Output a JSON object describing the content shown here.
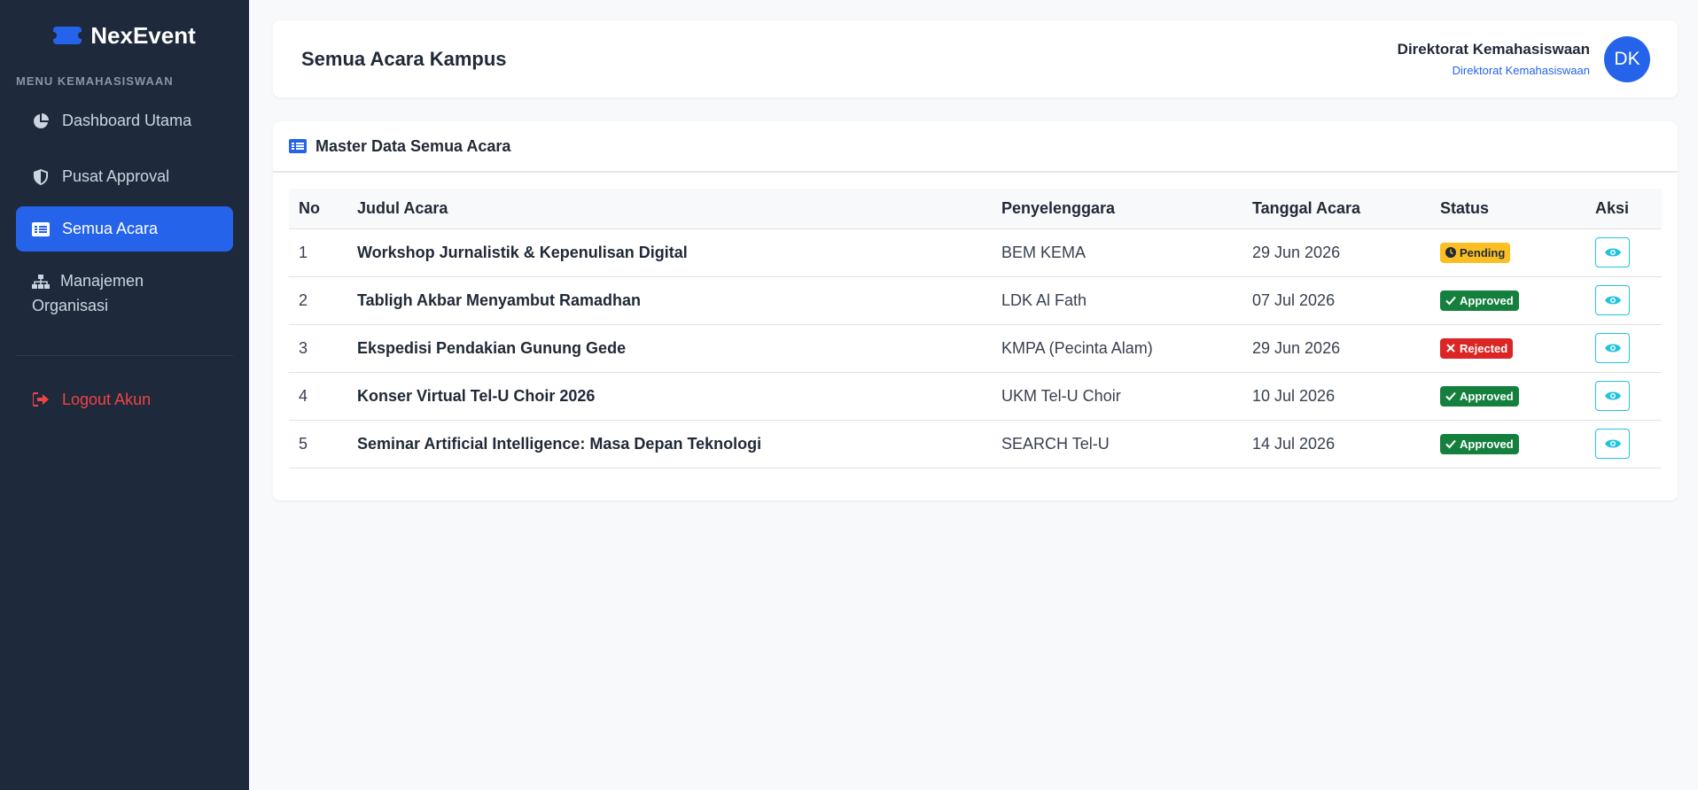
{
  "brand": {
    "name": "NexEvent"
  },
  "sidebar": {
    "heading": "MENU KEMAHASISWAAN",
    "items": [
      {
        "label": "Dashboard Utama",
        "icon": "pie-chart-icon"
      },
      {
        "label": "Pusat Approval",
        "icon": "shield-icon"
      },
      {
        "label": "Semua Acara",
        "icon": "list-icon",
        "active": true
      },
      {
        "label": "Manajemen Organisasi",
        "icon": "sitemap-icon"
      }
    ],
    "logout_label": "Logout Akun"
  },
  "header": {
    "title": "Semua Acara Kampus",
    "user_name": "Direktorat Kemahasiswaan",
    "user_role": "Direktorat Kemahasiswaan",
    "avatar_initials": "DK"
  },
  "card": {
    "title": "Master Data Semua Acara",
    "columns": [
      "No",
      "Judul Acara",
      "Penyelenggara",
      "Tanggal Acara",
      "Status",
      "Aksi"
    ],
    "rows": [
      {
        "no": "1",
        "title": "Workshop Jurnalistik & Kepenulisan Digital",
        "organizer": "BEM KEMA",
        "date": "29 Jun 2026",
        "status": "Pending"
      },
      {
        "no": "2",
        "title": "Tabligh Akbar Menyambut Ramadhan",
        "organizer": "LDK Al Fath",
        "date": "07 Jul 2026",
        "status": "Approved"
      },
      {
        "no": "3",
        "title": "Ekspedisi Pendakian Gunung Gede",
        "organizer": "KMPA (Pecinta Alam)",
        "date": "29 Jun 2026",
        "status": "Rejected"
      },
      {
        "no": "4",
        "title": "Konser Virtual Tel-U Choir 2026",
        "organizer": "UKM Tel-U Choir",
        "date": "10 Jul 2026",
        "status": "Approved"
      },
      {
        "no": "5",
        "title": "Seminar Artificial Intelligence: Masa Depan Teknologi",
        "organizer": "SEARCH Tel-U",
        "date": "14 Jul 2026",
        "status": "Approved"
      }
    ]
  },
  "colors": {
    "accent": "#2563eb",
    "sidebar_bg": "#1e293b",
    "pending": "#fbbf24",
    "approved": "#15803d",
    "rejected": "#dc2626",
    "view_button": "#22c3dd"
  }
}
